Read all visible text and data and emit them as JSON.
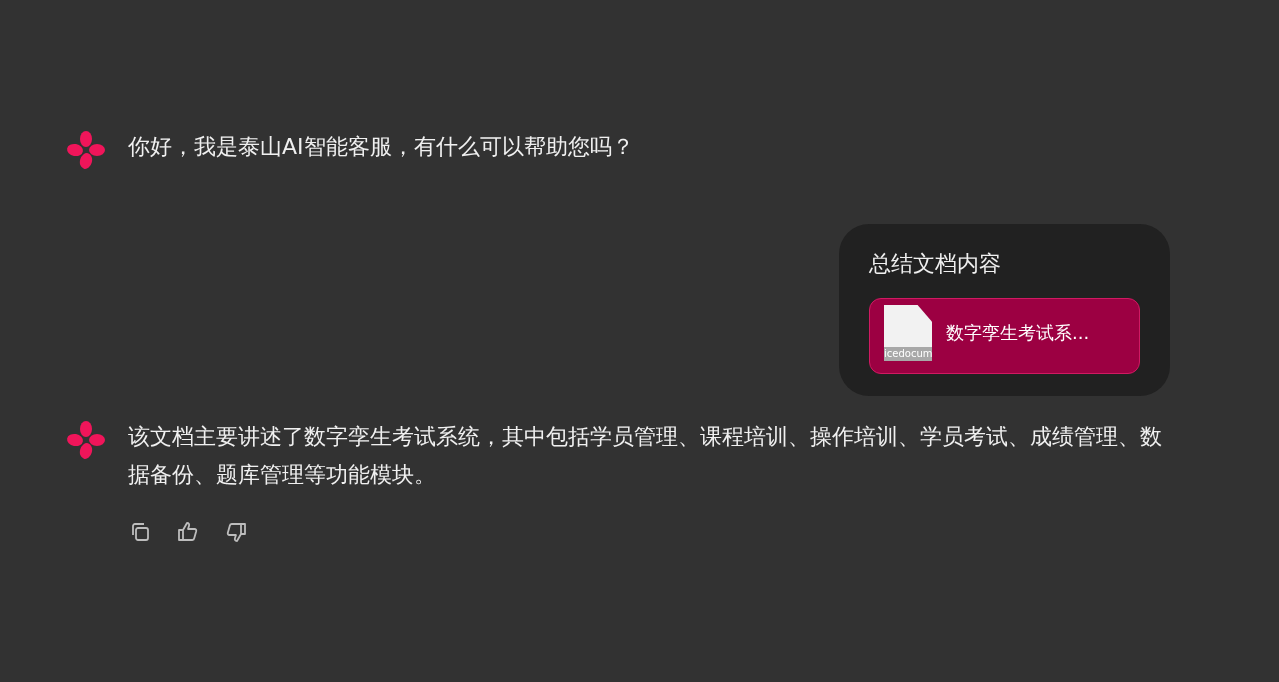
{
  "messages": [
    {
      "kind": "assistant",
      "text": "你好，我是泰山AI智能客服，有什么可以帮助您吗？"
    },
    {
      "kind": "user",
      "text": "总结文档内容",
      "attachment": {
        "type_label": "icedocum",
        "name": "数字孪生考试系..."
      }
    },
    {
      "kind": "assistant",
      "text": "该文档主要讲述了数字孪生考试系统，其中包括学员管理、课程培训、操作培训、学员考试、成绩管理、数据备份、题库管理等功能模块。",
      "actions": [
        {
          "kind": "copy"
        },
        {
          "kind": "like"
        },
        {
          "kind": "dislike"
        }
      ]
    }
  ]
}
